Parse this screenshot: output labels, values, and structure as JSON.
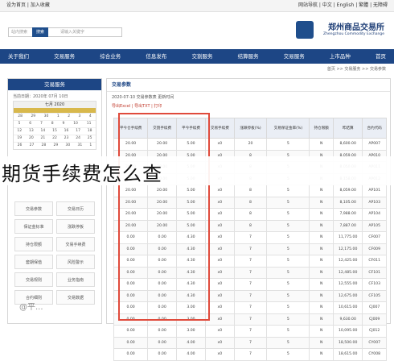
{
  "topbar": {
    "left": "设为首页 | 加入收藏",
    "right": "网站导航 | 中文 | English | 繁體 | 无障碍"
  },
  "header": {
    "logo_name": "郑州商品交易所",
    "logo_sub": "Zhengzhou Commodity Exchange",
    "search_placeholder": "请输入关键字",
    "search_button": "搜索",
    "search_placeholder2": "站内搜索"
  },
  "nav": [
    "首页",
    "上市品种",
    "交易服务",
    "结算服务",
    "交割服务",
    "信息发布",
    "综合业务",
    "交易服务",
    "关于我们"
  ],
  "breadcrumb": "首页 >> 交易服务 >> 交易参数",
  "sidebar": {
    "title": "交易服务",
    "date": "当前日期：2020年 07月 10日",
    "month_label": "七月 2020",
    "cal_rows": [
      [
        "28",
        "29",
        "30",
        "1",
        "2",
        "3",
        "4"
      ],
      [
        "5",
        "6",
        "7",
        "8",
        "9",
        "10",
        "11"
      ],
      [
        "12",
        "13",
        "14",
        "15",
        "16",
        "17",
        "18"
      ],
      [
        "19",
        "20",
        "21",
        "22",
        "23",
        "24",
        "25"
      ],
      [
        "26",
        "27",
        "28",
        "29",
        "30",
        "31",
        "1"
      ]
    ],
    "buttons": [
      "交易参数",
      "交易日历",
      "保证金标准",
      "涨跌停板",
      "持仓限额",
      "交易手续费",
      "套期保值",
      "风险警示",
      "交易规则",
      "业务指南",
      "合约细则",
      "交易数据"
    ]
  },
  "main": {
    "title": "交易参数",
    "subline": "2020-07-10   交易参数表   更新时间",
    "toolbar": "导出Excel  |  导出TXT  |  打印",
    "headers": [
      "合约代码",
      "昨结算",
      "持仓限额",
      "交易保证金率(%)",
      "涨跌停板(%)",
      "交易手续费",
      "平今手续费",
      "交割手续费",
      "平今仓手续费"
    ],
    "rows": [
      [
        "AP007",
        "8,600.00",
        "N",
        "5",
        "20",
        "x0",
        "5.00",
        "20.00",
        "20.00"
      ],
      [
        "AP010",
        "8,059.00",
        "N",
        "5",
        "8",
        "x0",
        "5.00",
        "20.00",
        "20.00"
      ],
      [
        "AP011",
        "8,050.00",
        "N",
        "5",
        "8",
        "x0",
        "5.00",
        "20.00",
        "20.00"
      ],
      [
        "AP012",
        "8,158.00",
        "N",
        "5",
        "8",
        "x0",
        "5.00",
        "20.00",
        "20.00"
      ],
      [
        "AP101",
        "8,059.00",
        "N",
        "5",
        "8",
        "x0",
        "5.00",
        "20.00",
        "20.00"
      ],
      [
        "AP103",
        "8,105.00",
        "N",
        "5",
        "8",
        "x0",
        "5.00",
        "20.00",
        "20.00"
      ],
      [
        "AP104",
        "7,988.00",
        "N",
        "5",
        "8",
        "x0",
        "5.00",
        "20.00",
        "20.00"
      ],
      [
        "AP105",
        "7,887.00",
        "N",
        "5",
        "8",
        "x0",
        "5.00",
        "20.00",
        "20.00"
      ],
      [
        "CF007",
        "11,775.00",
        "N",
        "5",
        "7",
        "x0",
        "4.30",
        "0.00",
        "0.00"
      ],
      [
        "CF009",
        "12,175.00",
        "N",
        "5",
        "7",
        "x0",
        "4.30",
        "0.00",
        "0.00"
      ],
      [
        "CF011",
        "12,425.00",
        "N",
        "5",
        "7",
        "x0",
        "4.30",
        "0.00",
        "0.00"
      ],
      [
        "CF101",
        "12,485.00",
        "N",
        "5",
        "7",
        "x0",
        "4.30",
        "0.00",
        "0.00"
      ],
      [
        "CF103",
        "12,555.00",
        "N",
        "5",
        "7",
        "x0",
        "4.30",
        "0.00",
        "0.00"
      ],
      [
        "CF105",
        "12,675.00",
        "N",
        "5",
        "7",
        "x0",
        "4.30",
        "0.00",
        "0.00"
      ],
      [
        "CJ007",
        "10,615.00",
        "N",
        "5",
        "7",
        "x0",
        "3.00",
        "0.00",
        "0.00"
      ],
      [
        "CJ009",
        "9,630.00",
        "N",
        "5",
        "7",
        "x0",
        "3.00",
        "0.00",
        "0.00"
      ],
      [
        "CJ012",
        "10,095.00",
        "N",
        "5",
        "7",
        "x0",
        "3.00",
        "0.00",
        "0.00"
      ],
      [
        "CY007",
        "18,500.00",
        "N",
        "5",
        "7",
        "x0",
        "4.00",
        "0.00",
        "0.00"
      ],
      [
        "CY008",
        "18,615.00",
        "N",
        "5",
        "7",
        "x0",
        "4.00",
        "0.00",
        "0.00"
      ]
    ]
  },
  "overlay_title": "期货手续费怎么查",
  "watermark": "@平..."
}
